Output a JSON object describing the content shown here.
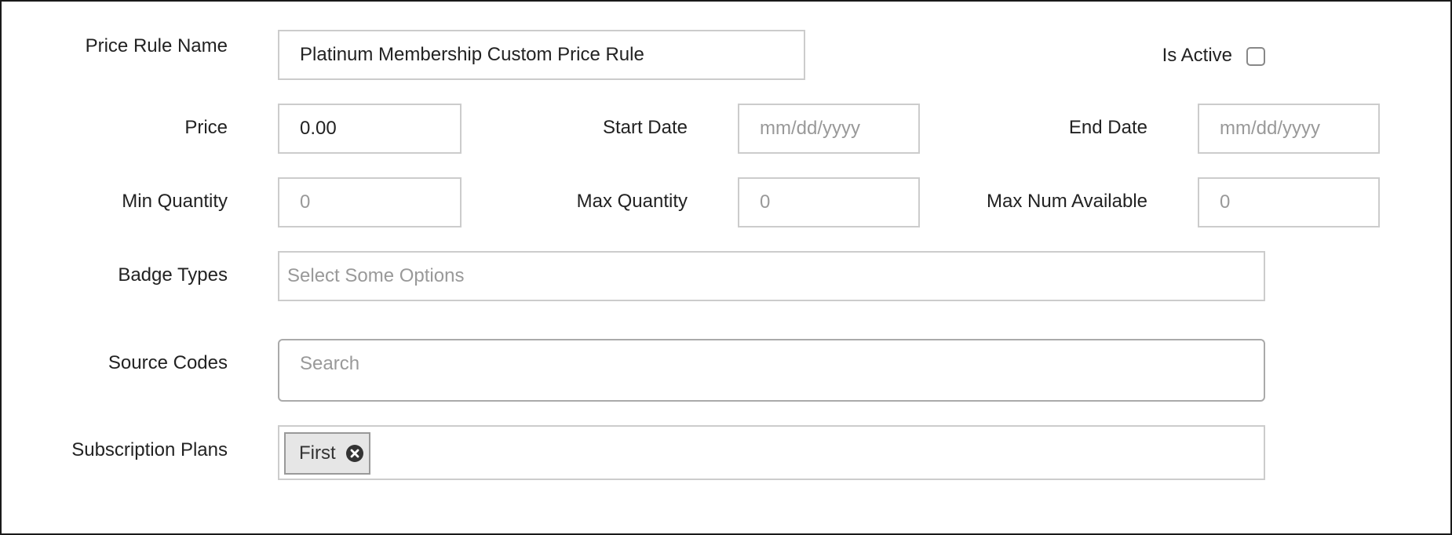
{
  "form": {
    "price_rule_name": {
      "label": "Price Rule Name",
      "value": "Platinum Membership Custom Price Rule"
    },
    "is_active": {
      "label": "Is Active",
      "checked": false
    },
    "price": {
      "label": "Price",
      "value": "0.00"
    },
    "start_date": {
      "label": "Start Date",
      "placeholder": "mm/dd/yyyy"
    },
    "end_date": {
      "label": "End Date",
      "placeholder": "mm/dd/yyyy"
    },
    "min_quantity": {
      "label": "Min Quantity",
      "placeholder": "0"
    },
    "max_quantity": {
      "label": "Max Quantity",
      "placeholder": "0"
    },
    "max_num_available": {
      "label": "Max Num Available",
      "placeholder": "0"
    },
    "badge_types": {
      "label": "Badge Types",
      "placeholder": "Select Some Options"
    },
    "source_codes": {
      "label": "Source Codes",
      "placeholder": "Search"
    },
    "subscription_plans": {
      "label": "Subscription Plans",
      "selected": [
        {
          "label": "First",
          "icon": "remove-circle-icon"
        }
      ]
    }
  },
  "colors": {
    "border": "#cccccc",
    "text": "#222222",
    "placeholder": "#999999",
    "tag_background": "#e6e6e6"
  }
}
